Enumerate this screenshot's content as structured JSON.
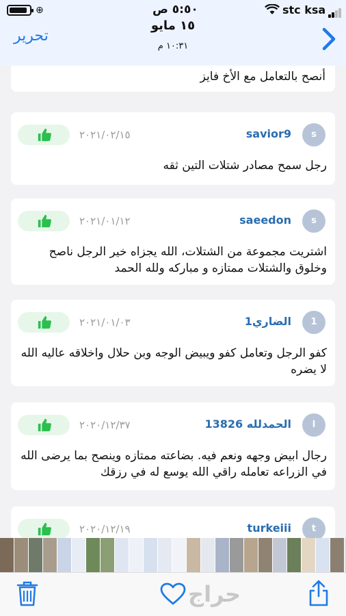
{
  "status_bar": {
    "time": "٥:٥٠ ص",
    "carrier": "stc ksa"
  },
  "header": {
    "date": "١٥ مايو",
    "time": "١٠:٣١ م",
    "edit_label": "تحرير",
    "back_icon": "chevron-right-icon"
  },
  "comments": [
    {
      "text": "أنصح بالتعامل مع الأخ فايز"
    },
    {
      "avatar": "s",
      "user": "savior9",
      "date": "٢٠٢١/٠٢/١٥",
      "body": "رجل سمح مصادر شتلات التين ثقه"
    },
    {
      "avatar": "s",
      "user": "saeedon",
      "date": "٢٠٢١/٠١/١٢",
      "body": "اشتريت مجموعة من الشتلات، الله يجزاه خير الرجل ناصح وخلوق  والشتلات ممتازه و مباركه  ولله الحمد"
    },
    {
      "avatar": "1",
      "user": "1الضاري",
      "date": "٢٠٢١/٠١/٠٣",
      "body": "كفو الرجل وتعامل كفو ويبيض الوجه وبن حلال واخلاقه عاليه الله لا يضره"
    },
    {
      "avatar": "ا",
      "user": "الحمدلله 13826",
      "date": "٢٠٢٠/١٢/٣٧",
      "body": "رجال ابيض وجهه ونعم فيه. بضاعته ممتازه وينصح بما يرضى الله في الزراعه تعامله راقي الله يوسع له في رزقك"
    },
    {
      "avatar": "t",
      "user": "turkeiii",
      "date": "٢٠٢٠/١٢/١٩",
      "body": ""
    }
  ],
  "toolbar": {
    "trash_icon": "trash-icon",
    "heart_icon": "heart-icon",
    "share_icon": "share-icon",
    "watermark": "حراج"
  },
  "colors": {
    "accent": "#1f7ae6",
    "like_bg": "#e6f7ea",
    "like_icon": "#2bbf4e",
    "username": "#2a6db0"
  }
}
